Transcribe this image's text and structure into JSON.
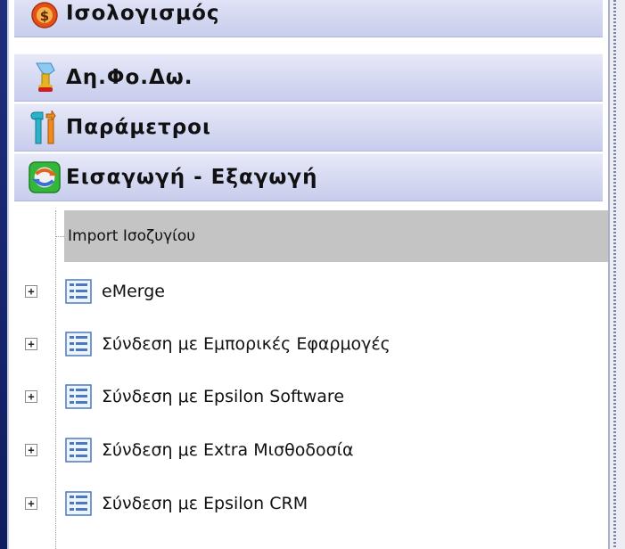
{
  "groups": [
    {
      "label": "Ισολογισμός",
      "icon": "money-bag-icon"
    },
    {
      "label": "Δη.Φο.Δω.",
      "icon": "trophy-icon"
    },
    {
      "label": "Παράμετροι",
      "icon": "tools-icon"
    },
    {
      "label": "Εισαγωγή - Εξαγωγή",
      "icon": "import-export-icon"
    }
  ],
  "selected_item": {
    "label": "Import Ισοζυγίου"
  },
  "tree_items": [
    {
      "label": "eMerge",
      "expander": "+"
    },
    {
      "label": "Σύνδεση με Εμπορικές Εφαρμογές",
      "expander": "+"
    },
    {
      "label": "Σύνδεση με Epsilon Software",
      "expander": "+"
    },
    {
      "label": "Σύνδεση με Extra Μισθοδοσία",
      "expander": "+"
    },
    {
      "label": "Σύνδεση με Epsilon CRM",
      "expander": "+"
    }
  ],
  "colors": {
    "header_bg": "#d8dcf3",
    "selected_bg": "#c4c4c4",
    "strip": "#1e2e7c"
  }
}
